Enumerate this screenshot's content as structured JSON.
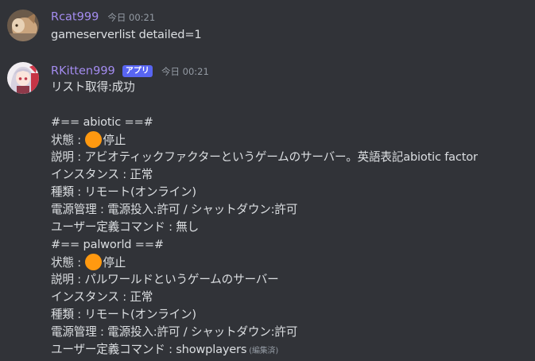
{
  "messages": [
    {
      "username": "Rcat999",
      "username_color": "#a48cf0",
      "timestamp": "今日 00:21",
      "avatar": "cat-photo-avatar",
      "content": "gameserverlist detailed=1"
    },
    {
      "username": "RKitten999",
      "username_color": "#a48cf0",
      "badge": "アプリ",
      "timestamp": "今日 00:21",
      "avatar": "anime-girl-avatar",
      "lines": {
        "l0": "リスト取得:成功",
        "l1": "#== abiotic ==#",
        "l2_prefix": "状態 : ",
        "l2_suffix": "停止",
        "l3": "説明 : アビオティックファクターというゲームのサーバー。英語表記abiotic factor",
        "l4": "インスタンス : 正常",
        "l5": "種類 : リモート(オンライン)",
        "l6": "電源管理 : 電源投入:許可 / シャットダウン:許可",
        "l7": "ユーザー定義コマンド : 無し",
        "l8": "#== palworld ==#",
        "l9_prefix": "状態 : ",
        "l9_suffix": "停止",
        "l10": "説明 : パルワールドというゲームのサーバー",
        "l11": "インスタンス : 正常",
        "l12": "種類 : リモート(オンライン)",
        "l13": "電源管理 : 電源投入:許可 / シャットダウン:許可",
        "l14": "ユーザー定義コマンド : showplayers",
        "edited": "(編集済)"
      },
      "status_icon": "orange-circle-icon",
      "status_color": "#ff9910"
    }
  ]
}
